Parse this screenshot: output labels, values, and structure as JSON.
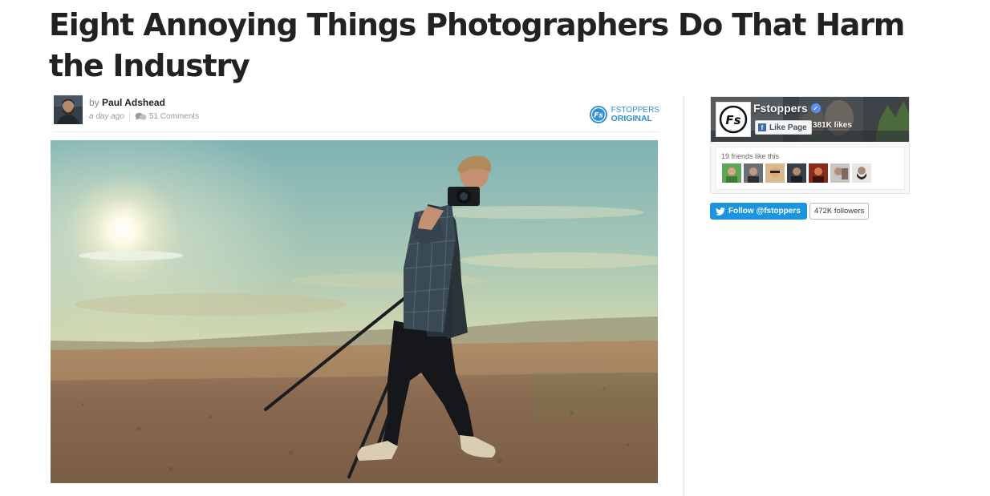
{
  "article": {
    "title": "Eight Annoying Things Photographers Do That Harm the Industry",
    "by_prefix": "by",
    "author": "Paul Adshead",
    "time": "a day ago",
    "comments": "51 Comments",
    "badge_line1": "FSTOPPERS",
    "badge_line2": "ORIGINAL",
    "hero_image": "photographer with camera on tripod in desert field at sunset"
  },
  "facebook": {
    "page_name": "Fstoppers",
    "like_label": "Like Page",
    "likes": "381K likes",
    "friends_text": "19 friends like this",
    "friend_count_shown": 7
  },
  "twitter": {
    "follow_label": "Follow @fstoppers",
    "followers": "472K followers"
  },
  "colors": {
    "title": "#222222",
    "fstoppers_blue": "#2e8fd6",
    "twitter_blue": "#1b95e0",
    "facebook_blue": "#4267b2"
  },
  "icons": {
    "comment": "comment-bubbles-icon",
    "badge": "fstoppers-logo-icon",
    "verified": "verified-check-icon",
    "facebook": "facebook-f-icon",
    "twitter": "twitter-bird-icon"
  }
}
